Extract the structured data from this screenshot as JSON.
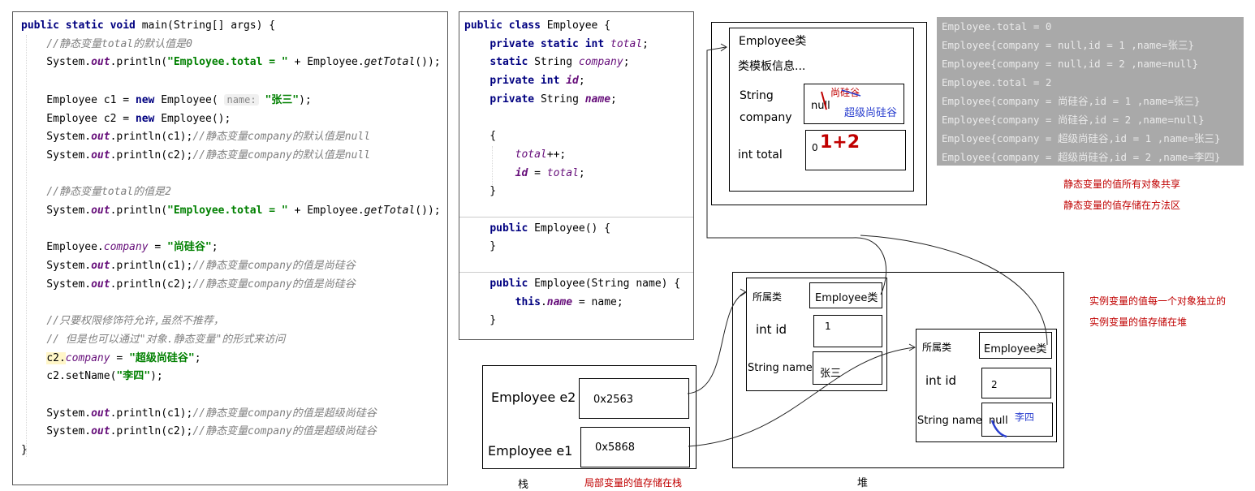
{
  "left_code": [
    [
      {
        "t": "public static void ",
        "c": "kw"
      },
      {
        "t": "main(String[] args) {"
      }
    ],
    [
      {
        "t": "    "
      },
      {
        "t": "//静态变量total的默认值是0",
        "c": "cmt"
      }
    ],
    [
      {
        "t": "    System."
      },
      {
        "t": "out",
        "c": "fldb"
      },
      {
        "t": ".println("
      },
      {
        "t": "\"Employee.total = \"",
        "c": "str"
      },
      {
        "t": " + Employee."
      },
      {
        "t": "getTotal",
        "c": "meth"
      },
      {
        "t": "());"
      }
    ],
    [
      {
        "t": ""
      }
    ],
    [
      {
        "t": "    Employee c1 = "
      },
      {
        "t": "new ",
        "c": "kw"
      },
      {
        "t": "Employee( "
      },
      {
        "t": "name:",
        "c": "hint"
      },
      {
        "t": " "
      },
      {
        "t": "\"张三\"",
        "c": "str"
      },
      {
        "t": ");"
      }
    ],
    [
      {
        "t": "    Employee c2 = "
      },
      {
        "t": "new ",
        "c": "kw"
      },
      {
        "t": "Employee();"
      }
    ],
    [
      {
        "t": "    System."
      },
      {
        "t": "out",
        "c": "fldb"
      },
      {
        "t": ".println(c1);"
      },
      {
        "t": "//静态变量company的默认值是null",
        "c": "cmt"
      }
    ],
    [
      {
        "t": "    System."
      },
      {
        "t": "out",
        "c": "fldb"
      },
      {
        "t": ".println(c2);"
      },
      {
        "t": "//静态变量company的默认值是null",
        "c": "cmt"
      }
    ],
    [
      {
        "t": ""
      }
    ],
    [
      {
        "t": "    "
      },
      {
        "t": "//静态变量total的值是2",
        "c": "cmt"
      }
    ],
    [
      {
        "t": "    System."
      },
      {
        "t": "out",
        "c": "fldb"
      },
      {
        "t": ".println("
      },
      {
        "t": "\"Employee.total = \"",
        "c": "str"
      },
      {
        "t": " + Employee."
      },
      {
        "t": "getTotal",
        "c": "meth"
      },
      {
        "t": "());"
      }
    ],
    [
      {
        "t": ""
      }
    ],
    [
      {
        "t": "    Employee."
      },
      {
        "t": "company",
        "c": "fld"
      },
      {
        "t": " = "
      },
      {
        "t": "\"尚硅谷\"",
        "c": "str"
      },
      {
        "t": ";"
      }
    ],
    [
      {
        "t": "    System."
      },
      {
        "t": "out",
        "c": "fldb"
      },
      {
        "t": ".println(c1);"
      },
      {
        "t": "//静态变量company的值是尚硅谷",
        "c": "cmt"
      }
    ],
    [
      {
        "t": "    System."
      },
      {
        "t": "out",
        "c": "fldb"
      },
      {
        "t": ".println(c2);"
      },
      {
        "t": "//静态变量company的值是尚硅谷",
        "c": "cmt"
      }
    ],
    [
      {
        "t": ""
      }
    ],
    [
      {
        "t": "    "
      },
      {
        "t": "//只要权限修饰符允许,虽然不推荐，",
        "c": "cmt"
      }
    ],
    [
      {
        "t": "    "
      },
      {
        "t": "// 但是也可以通过\"对象.静态变量\"的形式来访问",
        "c": "cmt"
      }
    ],
    [
      {
        "t": "    "
      },
      {
        "t": "c2.",
        "c": "hl"
      },
      {
        "t": "company",
        "c": "fld"
      },
      {
        "t": " = "
      },
      {
        "t": "\"超级尚硅谷\"",
        "c": "str"
      },
      {
        "t": ";"
      }
    ],
    [
      {
        "t": "    c2.setName("
      },
      {
        "t": "\"李四\"",
        "c": "str"
      },
      {
        "t": ");"
      }
    ],
    [
      {
        "t": ""
      }
    ],
    [
      {
        "t": "    System."
      },
      {
        "t": "out",
        "c": "fldb"
      },
      {
        "t": ".println(c1);"
      },
      {
        "t": "//静态变量company的值是超级尚硅谷",
        "c": "cmt"
      }
    ],
    [
      {
        "t": "    System."
      },
      {
        "t": "out",
        "c": "fldb"
      },
      {
        "t": ".println(c2);"
      },
      {
        "t": "//静态变量company的值是超级尚硅谷",
        "c": "cmt"
      }
    ],
    [
      {
        "t": "}"
      }
    ]
  ],
  "mid_code": [
    [
      {
        "t": "public class ",
        "c": "kw"
      },
      {
        "t": "Employee {"
      }
    ],
    [
      {
        "t": "    "
      },
      {
        "t": "private static int ",
        "c": "kw"
      },
      {
        "t": "total",
        "c": "fld"
      },
      {
        "t": ";"
      }
    ],
    [
      {
        "t": "    "
      },
      {
        "t": "static ",
        "c": "kw"
      },
      {
        "t": "String "
      },
      {
        "t": "company",
        "c": "fld"
      },
      {
        "t": ";"
      }
    ],
    [
      {
        "t": "    "
      },
      {
        "t": "private int ",
        "c": "kw"
      },
      {
        "t": "id",
        "c": "fldb"
      },
      {
        "t": ";"
      }
    ],
    [
      {
        "t": "    "
      },
      {
        "t": "private ",
        "c": "kw"
      },
      {
        "t": "String "
      },
      {
        "t": "name",
        "c": "fldb"
      },
      {
        "t": ";"
      }
    ],
    [
      {
        "t": ""
      }
    ],
    [
      {
        "t": "    {"
      }
    ],
    [
      {
        "t": "        "
      },
      {
        "t": "total",
        "c": "fld"
      },
      {
        "t": "++;"
      }
    ],
    [
      {
        "t": "        "
      },
      {
        "t": "id",
        "c": "fldb"
      },
      {
        "t": " = "
      },
      {
        "t": "total",
        "c": "fld"
      },
      {
        "t": ";"
      }
    ],
    [
      {
        "t": "    }"
      }
    ],
    [
      {
        "t": ""
      }
    ],
    [
      {
        "t": "    "
      },
      {
        "t": "public ",
        "c": "kw"
      },
      {
        "t": "Employee() {"
      }
    ],
    [
      {
        "t": "    }"
      }
    ],
    [
      {
        "t": ""
      }
    ],
    [
      {
        "t": "    "
      },
      {
        "t": "public ",
        "c": "kw"
      },
      {
        "t": "Employee(String name) {"
      }
    ],
    [
      {
        "t": "        "
      },
      {
        "t": "this",
        "c": "kw"
      },
      {
        "t": "."
      },
      {
        "t": "name",
        "c": "fldb"
      },
      {
        "t": " = name;"
      }
    ],
    [
      {
        "t": "    }"
      }
    ]
  ],
  "console_lines": [
    "Employee.total = 0",
    "Employee{company = null,id = 1 ,name=张三}",
    "Employee{company = null,id = 2 ,name=null}",
    "Employee.total = 2",
    "Employee{company = 尚硅谷,id = 1 ,name=张三}",
    "Employee{company = 尚硅谷,id = 2 ,name=null}",
    "Employee{company = 超级尚硅谷,id = 1 ,name=张三}",
    "Employee{company = 超级尚硅谷,id = 2 ,name=李四}"
  ],
  "method_area": {
    "class_title": "Employee类",
    "template_info": "类模板信息...",
    "company_label_1": "String",
    "company_label_2": "company",
    "company_old": "null",
    "company_v1": "尚硅谷",
    "company_v2": "超级尚硅谷",
    "total_label": "int total",
    "total_old": "0",
    "total_scribble": "1+2"
  },
  "notes": {
    "static_shared": "静态变量的值所有对象共享",
    "static_method_area": "静态变量的值存储在方法区",
    "instance_independent": "实例变量的值每一个对象独立的",
    "instance_heap": "实例变量的值存储在堆",
    "local_stack": "局部变量的值存储在栈"
  },
  "stack": {
    "title": "栈",
    "e2_label": "Employee e2",
    "e2_addr": "0x2563",
    "e1_label": "Employee e1",
    "e1_addr": "0x5868"
  },
  "heap": {
    "title": "堆",
    "obj1": {
      "class_label": "所属类",
      "class_value": "Employee类",
      "id_label": "int id",
      "id_value": "1",
      "name_label": "String name",
      "name_value": "张三"
    },
    "obj2": {
      "class_label": "所属类",
      "class_value": "Employee类",
      "id_label": "int id",
      "id_value": "2",
      "name_label": "String name",
      "name_old": "null",
      "name_value": "李四"
    }
  }
}
